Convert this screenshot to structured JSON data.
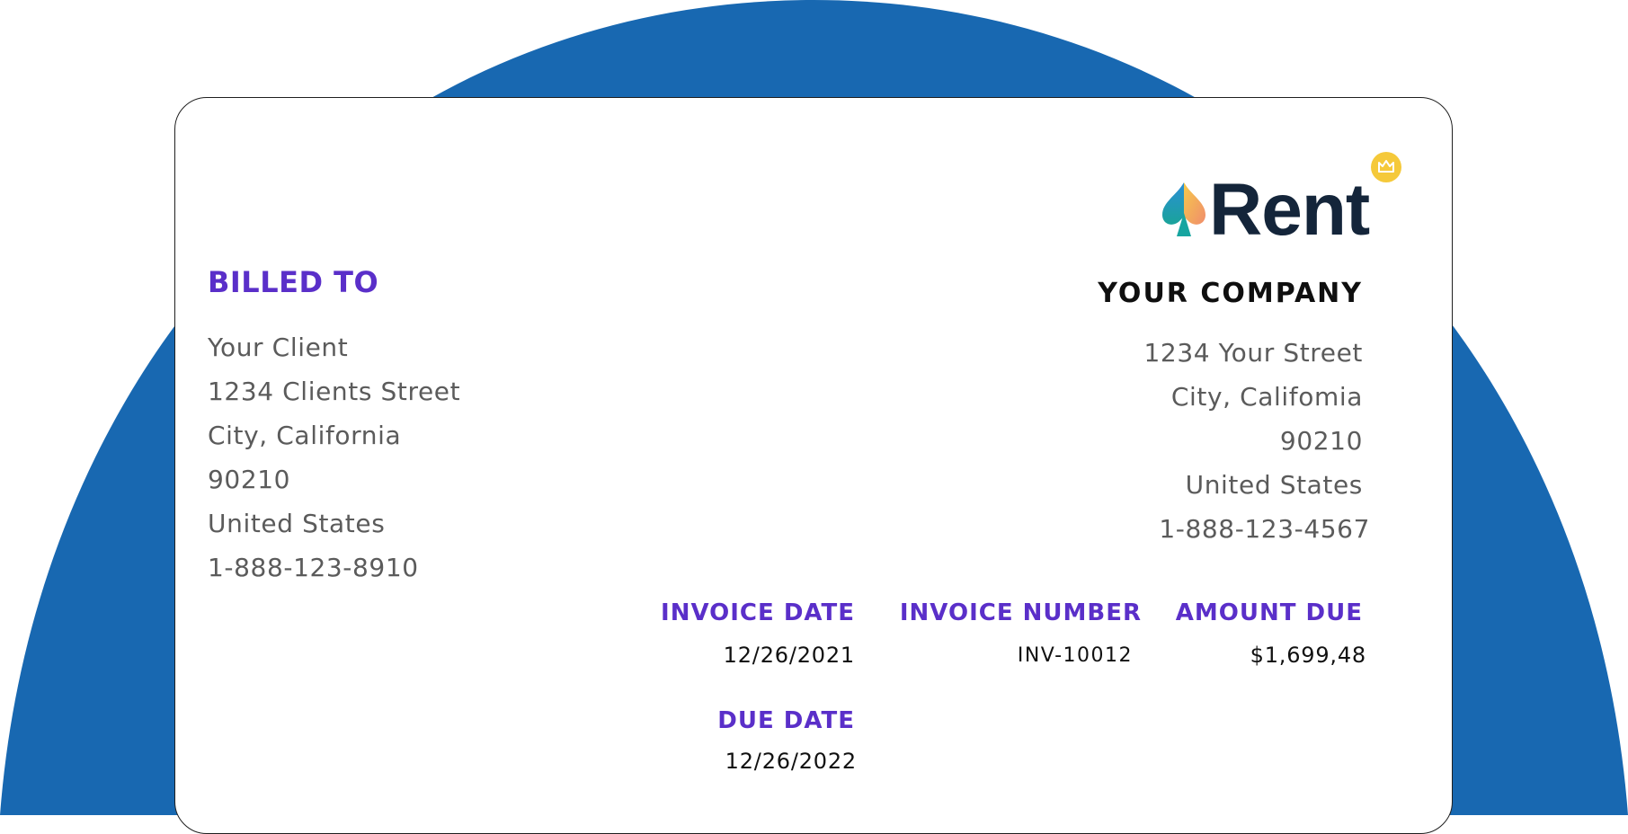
{
  "colors": {
    "background_shape": "#1868b1",
    "heading": "#5a2fc9",
    "address_text": "#5b5b5b",
    "value_text": "#111111",
    "brand_dark": "#14253a",
    "badge": "#f5c93a"
  },
  "logo": {
    "brand_name": "Rent",
    "icon": "spade-icon",
    "badge_icon": "crown-icon"
  },
  "billed_to": {
    "heading": "BILLED TO",
    "lines": [
      "Your Client",
      "1234 Clients Street",
      "City, California",
      "90210",
      "United States",
      "1-888-123-8910"
    ]
  },
  "company": {
    "name": "YOUR COMPANY",
    "lines": [
      "1234 Your Street",
      "City, Califomia",
      "90210",
      "United States",
      "1-888-123-4567"
    ]
  },
  "invoice": {
    "date_label": "INVOICE DATE",
    "date": "12/26/2021",
    "number_label": "INVOICE NUMBER",
    "number": "INV-10012",
    "amount_label": "AMOUNT DUE",
    "amount": "$1,699,48",
    "due_label": "DUE DATE",
    "due": "12/26/2022"
  }
}
